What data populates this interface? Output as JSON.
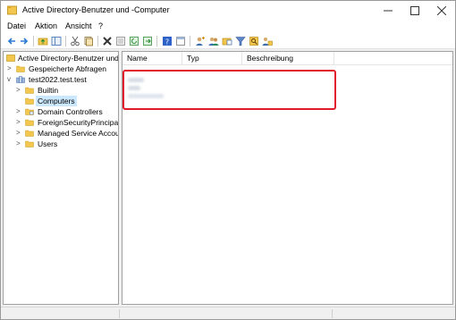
{
  "window": {
    "title": "Active Directory-Benutzer und -Computer",
    "controls": {
      "minimize": "—",
      "maximize": "☐",
      "close": "✕"
    }
  },
  "menu": [
    "Datei",
    "Aktion",
    "Ansicht",
    "?"
  ],
  "toolbar": {
    "icons": [
      "back-icon",
      "forward-icon",
      "up-folder-icon",
      "console-tree-icon",
      "cut-icon",
      "copy-icon",
      "delete-icon",
      "properties-icon",
      "refresh-icon",
      "export-icon",
      "help-icon",
      "view-icon",
      "add-user-icon",
      "add-group-icon",
      "add-ou-icon",
      "filter-icon",
      "find-icon",
      "add-to-group-icon"
    ]
  },
  "tree": {
    "root_label": "Active Directory-Benutzer und -",
    "items": [
      {
        "label": "Gespeicherte Abfragen",
        "level": 1,
        "expander": ">",
        "selected": false
      },
      {
        "label": "test2022.test.test",
        "level": 1,
        "expander": "v",
        "selected": false
      },
      {
        "label": "Builtin",
        "level": 2,
        "expander": ">",
        "selected": false
      },
      {
        "label": "Computers",
        "level": 2,
        "expander": "",
        "selected": true
      },
      {
        "label": "Domain Controllers",
        "level": 2,
        "expander": ">",
        "selected": false
      },
      {
        "label": "ForeignSecurityPrincipals",
        "level": 2,
        "expander": ">",
        "selected": false
      },
      {
        "label": "Managed Service Accour",
        "level": 2,
        "expander": ">",
        "selected": false
      },
      {
        "label": "Users",
        "level": 2,
        "expander": ">",
        "selected": false
      }
    ]
  },
  "list": {
    "columns": [
      "Name",
      "Typ",
      "Beschreibung"
    ],
    "rows_redacted": 3
  },
  "colors": {
    "highlight": "#e21b2b",
    "selection": "#cce8ff",
    "folder": "#f3c64d"
  }
}
